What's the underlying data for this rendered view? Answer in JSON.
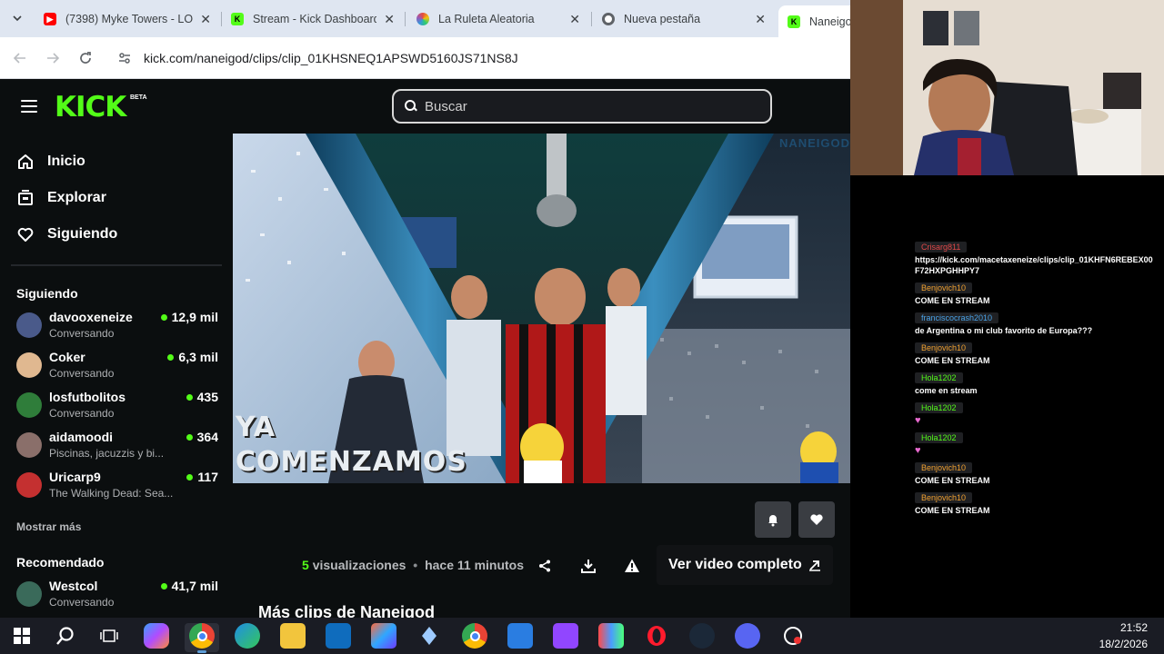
{
  "browser": {
    "tabs": [
      {
        "title": "(7398) Myke Towers - LO",
        "favicon_color": "#ff0000",
        "favicon": "youtube-icon"
      },
      {
        "title": "Stream - Kick Dashboard",
        "favicon_color": "#53fc18",
        "favicon": "kick-icon"
      },
      {
        "title": "La Ruleta Aleatoria",
        "favicon_color": "#8e44ad",
        "favicon": "wheel-icon"
      },
      {
        "title": "Nueva pestaña",
        "favicon_color": "#5f6368",
        "favicon": "chrome-icon"
      },
      {
        "title": "Naneigod",
        "favicon_color": "#53fc18",
        "favicon": "kick-icon"
      }
    ],
    "url": "kick.com/naneigod/clips/clip_01KHSNEQ1APSWD5160JS71NS8J"
  },
  "kick": {
    "logo": "KICK",
    "beta": "BETA",
    "search_placeholder": "Buscar",
    "nav": {
      "home": "Inicio",
      "explore": "Explorar",
      "following": "Siguiendo"
    },
    "following_title": "Siguiendo",
    "following": [
      {
        "name": "davooxeneize",
        "sub": "Conversando",
        "viewers": "12,9 mil",
        "avatar_color": "#4a5a8a"
      },
      {
        "name": "Coker",
        "sub": "Conversando",
        "viewers": "6,3 mil",
        "avatar_color": "#e0b890"
      },
      {
        "name": "losfutbolitos",
        "sub": "Conversando",
        "viewers": "435",
        "avatar_color": "#2f7d3a"
      },
      {
        "name": "aidamoodi",
        "sub": "Piscinas, jacuzzis y bi...",
        "viewers": "364",
        "avatar_color": "#8a6f6a"
      },
      {
        "name": "Uricarp9",
        "sub": "The Walking Dead: Sea...",
        "viewers": "117",
        "avatar_color": "#c43030"
      }
    ],
    "show_more": "Mostrar más",
    "recommended_title": "Recomendado",
    "recommended": [
      {
        "name": "Westcol",
        "sub": "Conversando",
        "viewers": "41,7 mil",
        "avatar_color": "#3a6a5a"
      }
    ],
    "video": {
      "watermark": "NANEIGOD",
      "overlay_line1": "YA",
      "overlay_line2": "COMENZAMOS"
    },
    "clip": {
      "views": "5",
      "views_label": "visualizaciones",
      "separator": "•",
      "time": "hace 11 minutos",
      "full_video": "Ver video completo"
    },
    "more_clips": "Más clips de Naneigod"
  },
  "chat": [
    {
      "user": "Crisarg811",
      "user_color": "#e04848",
      "text": "https://kick.com/macetaxeneize/clips/clip_01KHFN6REBEX00F72HXPGHHPY7"
    },
    {
      "user": "Benjovich10",
      "user_color": "#f0a030",
      "text": "COME EN STREAM"
    },
    {
      "user": "franciscocrash2010",
      "user_color": "#4aa3e8",
      "text": "de Argentina o mi club favorito de Europa???"
    },
    {
      "user": "Benjovich10",
      "user_color": "#f0a030",
      "text": "COME EN STREAM"
    },
    {
      "user": "Hola1202",
      "user_color": "#53fc18",
      "text": "come en stream"
    },
    {
      "user": "Hola1202",
      "user_color": "#53fc18",
      "text": "",
      "emote": true
    },
    {
      "user": "Hola1202",
      "user_color": "#53fc18",
      "text": "",
      "emote": true
    },
    {
      "user": "Benjovich10",
      "user_color": "#f0a030",
      "text": "COME EN STREAM"
    },
    {
      "user": "Benjovich10",
      "user_color": "#f0a030",
      "text": "COME EN STREAM"
    }
  ],
  "taskbar": {
    "time": "21:52",
    "date": "18/2/2026"
  }
}
